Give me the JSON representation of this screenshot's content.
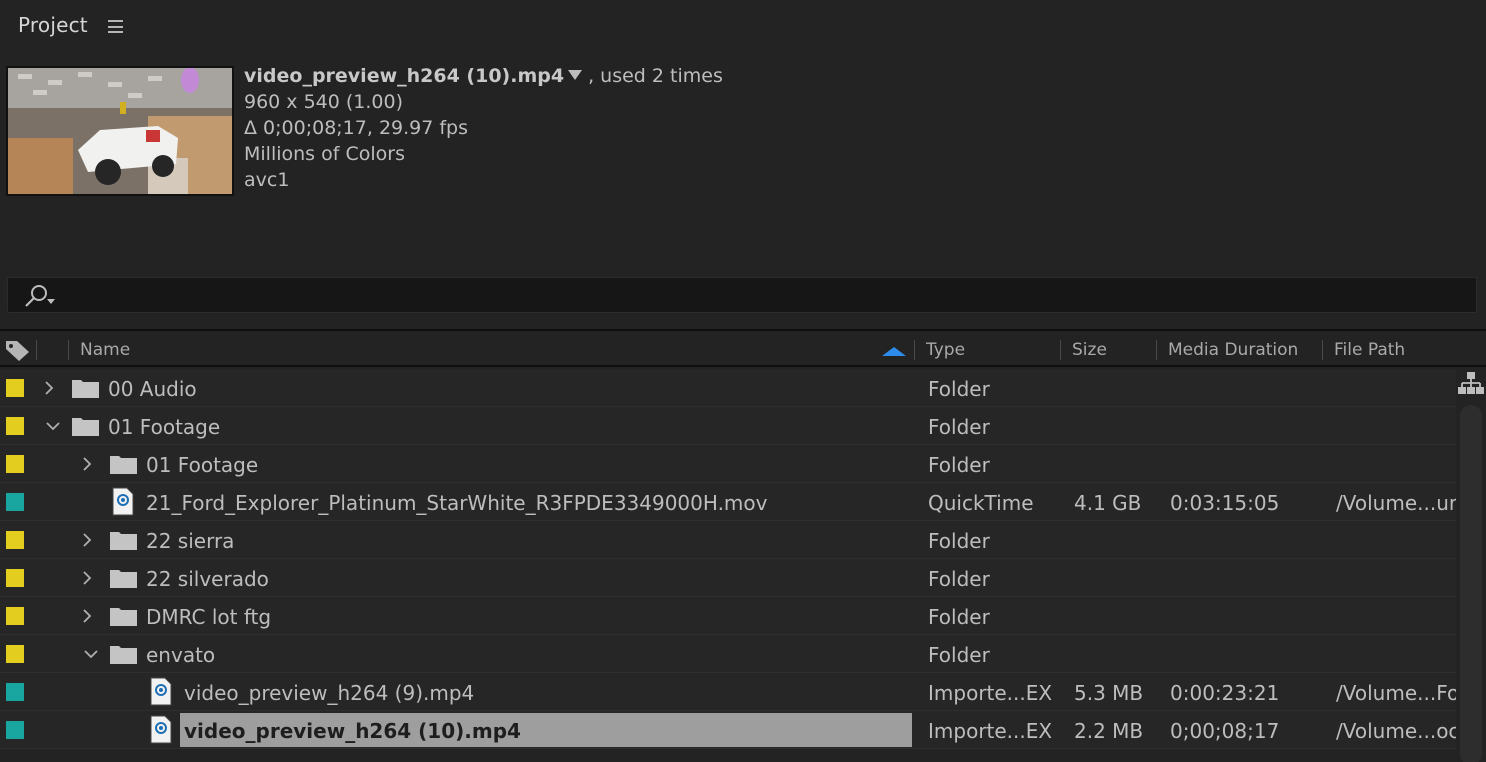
{
  "panel": {
    "title": "Project"
  },
  "preview": {
    "clip_name": "video_preview_h264 (10).mp4",
    "usage": ", used 2 times",
    "dimensions": "960 x 540 (1.00)",
    "duration": "Δ 0;00;08;17, 29.97 fps",
    "colors": "Millions of Colors",
    "codec": "avc1"
  },
  "search": {
    "value": "",
    "placeholder": ""
  },
  "columns": {
    "name": "Name",
    "type": "Type",
    "size": "Size",
    "media_duration": "Media Duration",
    "file_path": "File Path"
  },
  "colors": {
    "yellow_label": "#e3cd1f",
    "teal_label": "#1aa6a0",
    "sort_accent": "#2d8ceb",
    "selection": "#9e9e9e"
  },
  "rows": [
    {
      "label": "yellow",
      "icon": "folder-icon",
      "expanded": false,
      "name": "00 Audio",
      "type": "Folder",
      "size": "",
      "duration": "",
      "path": ""
    },
    {
      "label": "yellow",
      "icon": "folder-icon",
      "expanded": true,
      "name": "01 Footage",
      "type": "Folder",
      "size": "",
      "duration": "",
      "path": ""
    },
    {
      "label": "yellow",
      "icon": "folder-icon",
      "expanded": false,
      "name": "01 Footage",
      "type": "Folder",
      "size": "",
      "duration": "",
      "path": ""
    },
    {
      "label": "teal",
      "icon": "media-file-icon",
      "name": "21_Ford_Explorer_Platinum_StarWhite_R3FPDE3349000H.mov",
      "type": "QuickTime",
      "size": "4.1 GB",
      "duration": "0:03:15:05",
      "path": "/Volume...ur"
    },
    {
      "label": "yellow",
      "icon": "folder-icon",
      "expanded": false,
      "name": "22 sierra",
      "type": "Folder",
      "size": "",
      "duration": "",
      "path": ""
    },
    {
      "label": "yellow",
      "icon": "folder-icon",
      "expanded": false,
      "name": "22 silverado",
      "type": "Folder",
      "size": "",
      "duration": "",
      "path": ""
    },
    {
      "label": "yellow",
      "icon": "folder-icon",
      "expanded": false,
      "name": "DMRC lot ftg",
      "type": "Folder",
      "size": "",
      "duration": "",
      "path": ""
    },
    {
      "label": "yellow",
      "icon": "folder-icon",
      "expanded": true,
      "name": "envato",
      "type": "Folder",
      "size": "",
      "duration": "",
      "path": ""
    },
    {
      "label": "teal",
      "icon": "media-file-icon",
      "name": "video_preview_h264 (9).mp4",
      "type": "Importe...EX",
      "size": "5.3 MB",
      "duration": "0:00:23:21",
      "path": "/Volume...Fo"
    },
    {
      "label": "teal",
      "icon": "media-file-icon",
      "selected": true,
      "name": "video_preview_h264 (10).mp4",
      "type": "Importe...EX",
      "size": "2.2 MB",
      "duration": "0;00;08;17",
      "path": "/Volume...oc"
    }
  ]
}
